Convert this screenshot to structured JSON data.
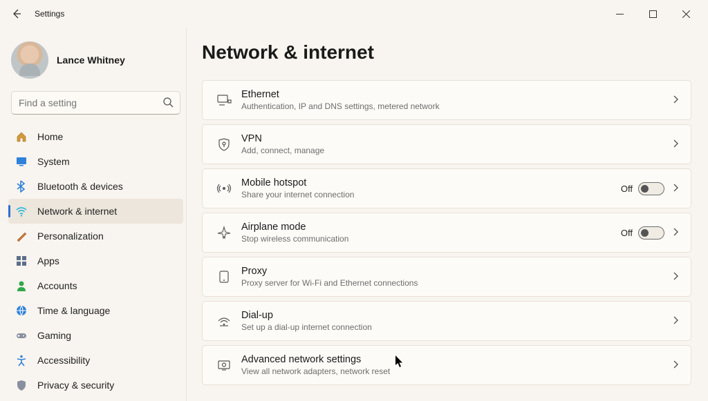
{
  "app": {
    "title": "Settings"
  },
  "profile": {
    "name": "Lance Whitney"
  },
  "search": {
    "placeholder": "Find a setting"
  },
  "nav": {
    "items": [
      {
        "id": "home",
        "label": "Home",
        "icon": "home"
      },
      {
        "id": "system",
        "label": "System",
        "icon": "system"
      },
      {
        "id": "bluetooth",
        "label": "Bluetooth & devices",
        "icon": "bluetooth"
      },
      {
        "id": "network",
        "label": "Network & internet",
        "icon": "wifi",
        "selected": true
      },
      {
        "id": "personalization",
        "label": "Personalization",
        "icon": "brush"
      },
      {
        "id": "apps",
        "label": "Apps",
        "icon": "apps"
      },
      {
        "id": "accounts",
        "label": "Accounts",
        "icon": "person"
      },
      {
        "id": "time",
        "label": "Time & language",
        "icon": "globe"
      },
      {
        "id": "gaming",
        "label": "Gaming",
        "icon": "gamepad"
      },
      {
        "id": "accessibility",
        "label": "Accessibility",
        "icon": "accessibility"
      },
      {
        "id": "privacy",
        "label": "Privacy & security",
        "icon": "shield"
      }
    ]
  },
  "page": {
    "title": "Network & internet",
    "cards": [
      {
        "id": "ethernet",
        "title": "Ethernet",
        "sub": "Authentication, IP and DNS settings, metered network",
        "icon": "ethernet"
      },
      {
        "id": "vpn",
        "title": "VPN",
        "sub": "Add, connect, manage",
        "icon": "vpn"
      },
      {
        "id": "hotspot",
        "title": "Mobile hotspot",
        "sub": "Share your internet connection",
        "icon": "hotspot",
        "toggle": "Off"
      },
      {
        "id": "airplane",
        "title": "Airplane mode",
        "sub": "Stop wireless communication",
        "icon": "airplane",
        "toggle": "Off"
      },
      {
        "id": "proxy",
        "title": "Proxy",
        "sub": "Proxy server for Wi-Fi and Ethernet connections",
        "icon": "proxy"
      },
      {
        "id": "dialup",
        "title": "Dial-up",
        "sub": "Set up a dial-up internet connection",
        "icon": "dialup"
      },
      {
        "id": "advanced",
        "title": "Advanced network settings",
        "sub": "View all network adapters, network reset",
        "icon": "advanced"
      }
    ]
  }
}
